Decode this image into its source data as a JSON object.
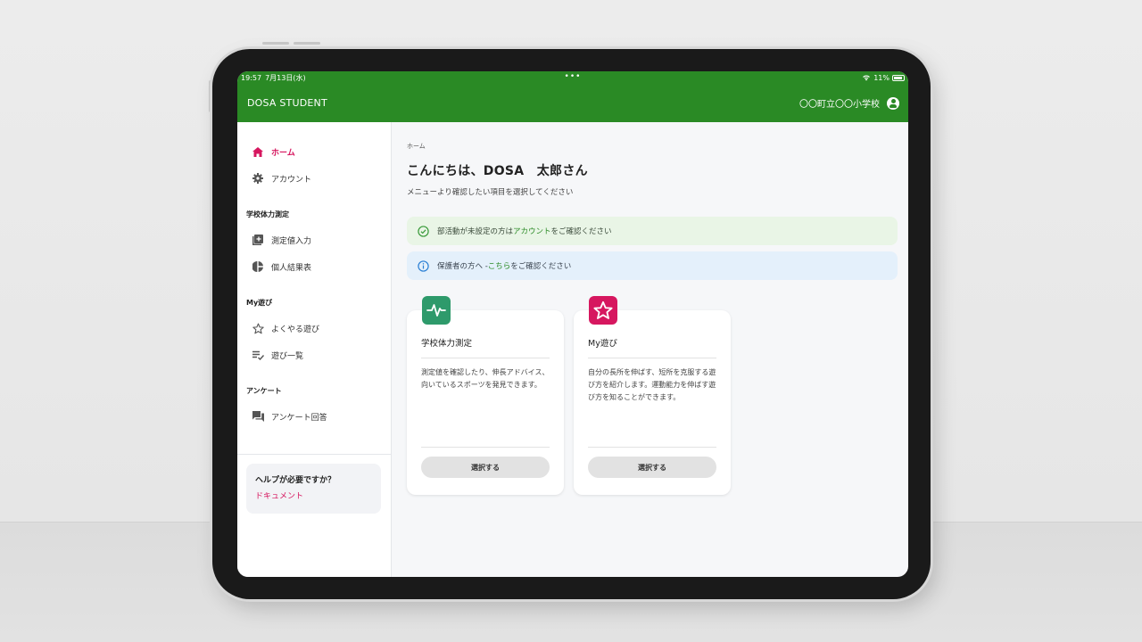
{
  "statusbar": {
    "time": "19:57",
    "date": "7月13日(水)",
    "dots": "•••",
    "battery": "11%"
  },
  "appbar": {
    "title": "DOSA STUDENT",
    "school": "〇〇町立〇〇小学校"
  },
  "sidebar": {
    "home": "ホーム",
    "account": "アカウント",
    "section_fitness": "学校体力測定",
    "measure_input": "測定値入力",
    "personal_results": "個人結果表",
    "section_play": "My遊び",
    "favorite_play": "よくやる遊び",
    "play_list": "遊び一覧",
    "section_survey": "アンケート",
    "survey_answer": "アンケート回答",
    "help_question": "ヘルプが必要ですか？",
    "help_document": "ドキュメント"
  },
  "main": {
    "breadcrumb": "ホーム",
    "greeting": "こんにちは、DOSA　太郎さん",
    "subgreeting": "メニューより確認したい項目を選択してください",
    "alert_success": {
      "before": "部活動が未設定の方は",
      "link": "アカウント",
      "after": "をご確認ください"
    },
    "alert_info": {
      "before": "保護者の方へ - ",
      "link": "こちら",
      "after": "をご確認ください"
    },
    "cards": [
      {
        "title": "学校体力測定",
        "description": "測定値を確認したり、伸長アドバイス、向いているスポーツを発見できます。",
        "button": "選択する",
        "icon": "pulse-icon",
        "color": "#2e9a6b"
      },
      {
        "title": "My遊び",
        "description": "自分の長所を伸ばす、短所を克服する遊び方を紹介します。運動能力を伸ばす遊び方を知ることができます。",
        "button": "選択する",
        "icon": "star-icon",
        "color": "#d6175f"
      }
    ]
  },
  "colors": {
    "brand_green": "#2a8a25",
    "accent_pink": "#d6175f"
  }
}
